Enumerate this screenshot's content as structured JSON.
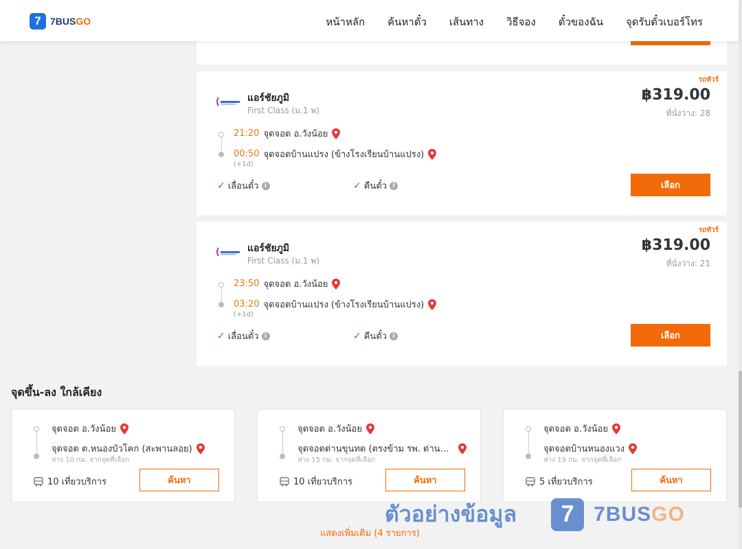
{
  "header": {
    "logo_mark": "7",
    "logo_text_a": "7BUS",
    "logo_text_b": "GO",
    "nav": [
      "หน้าหลัก",
      "ค้นหาตั๋ว",
      "เส้นทาง",
      "วิธีจอง",
      "ตั๋วของฉัน",
      "จุดรับตั๋วเบอร์โทร"
    ]
  },
  "trips": [
    {
      "tag": "รถทัวร์",
      "operator": "แอร์ชัยภูมิ",
      "class": "First Class (ม.1 พ)",
      "price": "฿319.00",
      "seats": "ที่นั่งว่าง: 28",
      "depart_time": "21:20",
      "depart_stop": "จุดจอด อ.วังน้อย",
      "arrive_time": "00:50",
      "arrive_stop": "จุดจอดบ้านแปรง (ข้างโรงเรียนบ้านแปรง)",
      "next_day": "(+1d)",
      "feature_1": "เลื่อนตั๋ว",
      "feature_2": "คืนตั๋ว",
      "select_label": "เลือก"
    },
    {
      "tag": "รถทัวร์",
      "operator": "แอร์ชัยภูมิ",
      "class": "First Class (ม.1 พ)",
      "price": "฿319.00",
      "seats": "ที่นั่งว่าง: 21",
      "depart_time": "23:50",
      "depart_stop": "จุดจอด อ.วังน้อย",
      "arrive_time": "03:20",
      "arrive_stop": "จุดจอดบ้านแปรง (ข้างโรงเรียนบ้านแปรง)",
      "next_day": "(+1d)",
      "feature_1": "เลื่อนตั๋ว",
      "feature_2": "คืนตั๋ว",
      "select_label": "เลือก"
    }
  ],
  "nearby": {
    "title": "จุดขึ้น-ลง ใกล้เคียง",
    "items": [
      {
        "from": "จุดจอด อ.วังน้อย",
        "to": "จุดจอด ต.หนองบัวโคก (สะพานลอย)",
        "distance": "ห่าง 10 กม. จากจุดที่เลือก",
        "trips": "10 เที่ยวบริการ",
        "button": "ค้นหา"
      },
      {
        "from": "จุดจอด อ.วังน้อย",
        "to": "จุดจอดด่านขุนทด (ตรงข้าม รพ. ด่านขุนทด)",
        "distance": "ห่าง 15 กม. จากจุดที่เลือก",
        "trips": "10 เที่ยวบริการ",
        "button": "ค้นหา"
      },
      {
        "from": "จุดจอด อ.วังน้อย",
        "to": "จุดจอดบ้านหนองแวง",
        "distance": "ห่าง 19 กม. จากจุดที่เลือก",
        "trips": "5 เที่ยวบริการ",
        "button": "ค้นหา"
      }
    ],
    "show_more": "แสดงเพิ่มเติม (4 รายการ)"
  },
  "watermark": {
    "text": "ตัวอย่างข้อมูล",
    "mark": "7",
    "brand_a": "7BUS",
    "brand_b": "GO"
  },
  "colors": {
    "accent": "#f26a0a",
    "brand_blue": "#1e6fe0",
    "check": "#3a9a2f"
  }
}
